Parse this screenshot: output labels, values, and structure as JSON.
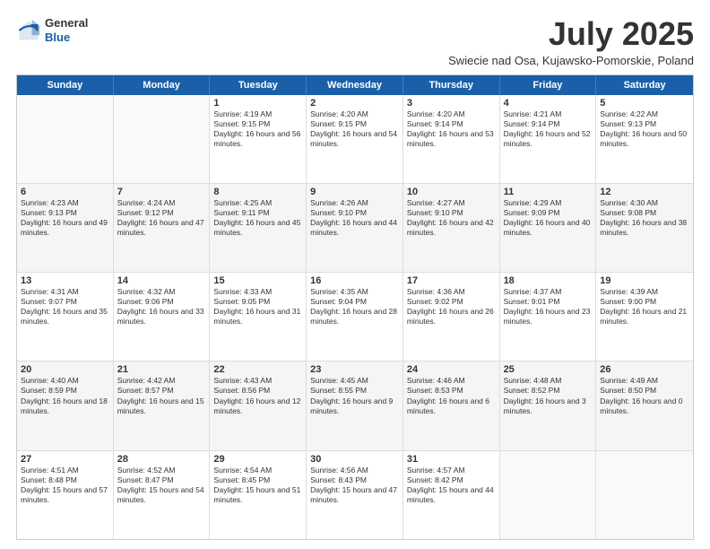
{
  "logo": {
    "general": "General",
    "blue": "Blue"
  },
  "title": "July 2025",
  "location": "Swiecie nad Osa, Kujawsko-Pomorskie, Poland",
  "days_of_week": [
    "Sunday",
    "Monday",
    "Tuesday",
    "Wednesday",
    "Thursday",
    "Friday",
    "Saturday"
  ],
  "weeks": [
    [
      {
        "day": "",
        "sunrise": "",
        "sunset": "",
        "daylight": "",
        "empty": true
      },
      {
        "day": "",
        "sunrise": "",
        "sunset": "",
        "daylight": "",
        "empty": true
      },
      {
        "day": "1",
        "sunrise": "Sunrise: 4:19 AM",
        "sunset": "Sunset: 9:15 PM",
        "daylight": "Daylight: 16 hours and 56 minutes."
      },
      {
        "day": "2",
        "sunrise": "Sunrise: 4:20 AM",
        "sunset": "Sunset: 9:15 PM",
        "daylight": "Daylight: 16 hours and 54 minutes."
      },
      {
        "day": "3",
        "sunrise": "Sunrise: 4:20 AM",
        "sunset": "Sunset: 9:14 PM",
        "daylight": "Daylight: 16 hours and 53 minutes."
      },
      {
        "day": "4",
        "sunrise": "Sunrise: 4:21 AM",
        "sunset": "Sunset: 9:14 PM",
        "daylight": "Daylight: 16 hours and 52 minutes."
      },
      {
        "day": "5",
        "sunrise": "Sunrise: 4:22 AM",
        "sunset": "Sunset: 9:13 PM",
        "daylight": "Daylight: 16 hours and 50 minutes."
      }
    ],
    [
      {
        "day": "6",
        "sunrise": "Sunrise: 4:23 AM",
        "sunset": "Sunset: 9:13 PM",
        "daylight": "Daylight: 16 hours and 49 minutes."
      },
      {
        "day": "7",
        "sunrise": "Sunrise: 4:24 AM",
        "sunset": "Sunset: 9:12 PM",
        "daylight": "Daylight: 16 hours and 47 minutes."
      },
      {
        "day": "8",
        "sunrise": "Sunrise: 4:25 AM",
        "sunset": "Sunset: 9:11 PM",
        "daylight": "Daylight: 16 hours and 45 minutes."
      },
      {
        "day": "9",
        "sunrise": "Sunrise: 4:26 AM",
        "sunset": "Sunset: 9:10 PM",
        "daylight": "Daylight: 16 hours and 44 minutes."
      },
      {
        "day": "10",
        "sunrise": "Sunrise: 4:27 AM",
        "sunset": "Sunset: 9:10 PM",
        "daylight": "Daylight: 16 hours and 42 minutes."
      },
      {
        "day": "11",
        "sunrise": "Sunrise: 4:29 AM",
        "sunset": "Sunset: 9:09 PM",
        "daylight": "Daylight: 16 hours and 40 minutes."
      },
      {
        "day": "12",
        "sunrise": "Sunrise: 4:30 AM",
        "sunset": "Sunset: 9:08 PM",
        "daylight": "Daylight: 16 hours and 38 minutes."
      }
    ],
    [
      {
        "day": "13",
        "sunrise": "Sunrise: 4:31 AM",
        "sunset": "Sunset: 9:07 PM",
        "daylight": "Daylight: 16 hours and 35 minutes."
      },
      {
        "day": "14",
        "sunrise": "Sunrise: 4:32 AM",
        "sunset": "Sunset: 9:06 PM",
        "daylight": "Daylight: 16 hours and 33 minutes."
      },
      {
        "day": "15",
        "sunrise": "Sunrise: 4:33 AM",
        "sunset": "Sunset: 9:05 PM",
        "daylight": "Daylight: 16 hours and 31 minutes."
      },
      {
        "day": "16",
        "sunrise": "Sunrise: 4:35 AM",
        "sunset": "Sunset: 9:04 PM",
        "daylight": "Daylight: 16 hours and 28 minutes."
      },
      {
        "day": "17",
        "sunrise": "Sunrise: 4:36 AM",
        "sunset": "Sunset: 9:02 PM",
        "daylight": "Daylight: 16 hours and 26 minutes."
      },
      {
        "day": "18",
        "sunrise": "Sunrise: 4:37 AM",
        "sunset": "Sunset: 9:01 PM",
        "daylight": "Daylight: 16 hours and 23 minutes."
      },
      {
        "day": "19",
        "sunrise": "Sunrise: 4:39 AM",
        "sunset": "Sunset: 9:00 PM",
        "daylight": "Daylight: 16 hours and 21 minutes."
      }
    ],
    [
      {
        "day": "20",
        "sunrise": "Sunrise: 4:40 AM",
        "sunset": "Sunset: 8:59 PM",
        "daylight": "Daylight: 16 hours and 18 minutes."
      },
      {
        "day": "21",
        "sunrise": "Sunrise: 4:42 AM",
        "sunset": "Sunset: 8:57 PM",
        "daylight": "Daylight: 16 hours and 15 minutes."
      },
      {
        "day": "22",
        "sunrise": "Sunrise: 4:43 AM",
        "sunset": "Sunset: 8:56 PM",
        "daylight": "Daylight: 16 hours and 12 minutes."
      },
      {
        "day": "23",
        "sunrise": "Sunrise: 4:45 AM",
        "sunset": "Sunset: 8:55 PM",
        "daylight": "Daylight: 16 hours and 9 minutes."
      },
      {
        "day": "24",
        "sunrise": "Sunrise: 4:46 AM",
        "sunset": "Sunset: 8:53 PM",
        "daylight": "Daylight: 16 hours and 6 minutes."
      },
      {
        "day": "25",
        "sunrise": "Sunrise: 4:48 AM",
        "sunset": "Sunset: 8:52 PM",
        "daylight": "Daylight: 16 hours and 3 minutes."
      },
      {
        "day": "26",
        "sunrise": "Sunrise: 4:49 AM",
        "sunset": "Sunset: 8:50 PM",
        "daylight": "Daylight: 16 hours and 0 minutes."
      }
    ],
    [
      {
        "day": "27",
        "sunrise": "Sunrise: 4:51 AM",
        "sunset": "Sunset: 8:48 PM",
        "daylight": "Daylight: 15 hours and 57 minutes."
      },
      {
        "day": "28",
        "sunrise": "Sunrise: 4:52 AM",
        "sunset": "Sunset: 8:47 PM",
        "daylight": "Daylight: 15 hours and 54 minutes."
      },
      {
        "day": "29",
        "sunrise": "Sunrise: 4:54 AM",
        "sunset": "Sunset: 8:45 PM",
        "daylight": "Daylight: 15 hours and 51 minutes."
      },
      {
        "day": "30",
        "sunrise": "Sunrise: 4:56 AM",
        "sunset": "Sunset: 8:43 PM",
        "daylight": "Daylight: 15 hours and 47 minutes."
      },
      {
        "day": "31",
        "sunrise": "Sunrise: 4:57 AM",
        "sunset": "Sunset: 8:42 PM",
        "daylight": "Daylight: 15 hours and 44 minutes."
      },
      {
        "day": "",
        "sunrise": "",
        "sunset": "",
        "daylight": "",
        "empty": true
      },
      {
        "day": "",
        "sunrise": "",
        "sunset": "",
        "daylight": "",
        "empty": true
      }
    ]
  ]
}
